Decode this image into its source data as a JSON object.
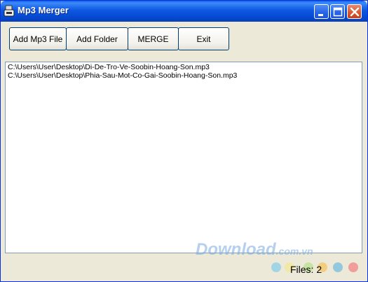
{
  "window": {
    "title": "Mp3 Merger"
  },
  "toolbar": {
    "add_file_label": "Add Mp3 File",
    "add_folder_label": "Add Folder",
    "merge_label": "MERGE",
    "exit_label": "Exit"
  },
  "files": [
    "C:\\Users\\User\\Desktop\\Di-De-Tro-Ve-Soobin-Hoang-Son.mp3",
    "C:\\Users\\User\\Desktop\\Phia-Sau-Mot-Co-Gai-Soobin-Hoang-Son.mp3"
  ],
  "status": {
    "files_count_text": "Files: 2"
  },
  "watermark": {
    "main": "Download",
    "suffix": ".com.vn"
  },
  "colors": {
    "titlebar": "#0548d0",
    "window_bg": "#ece9d8",
    "close_button": "#d8562f",
    "dot_colors": [
      "#8ed0e8",
      "#f3e69a",
      "#b7e08c",
      "#f6c25c",
      "#7ec0de",
      "#f08b8b"
    ]
  }
}
